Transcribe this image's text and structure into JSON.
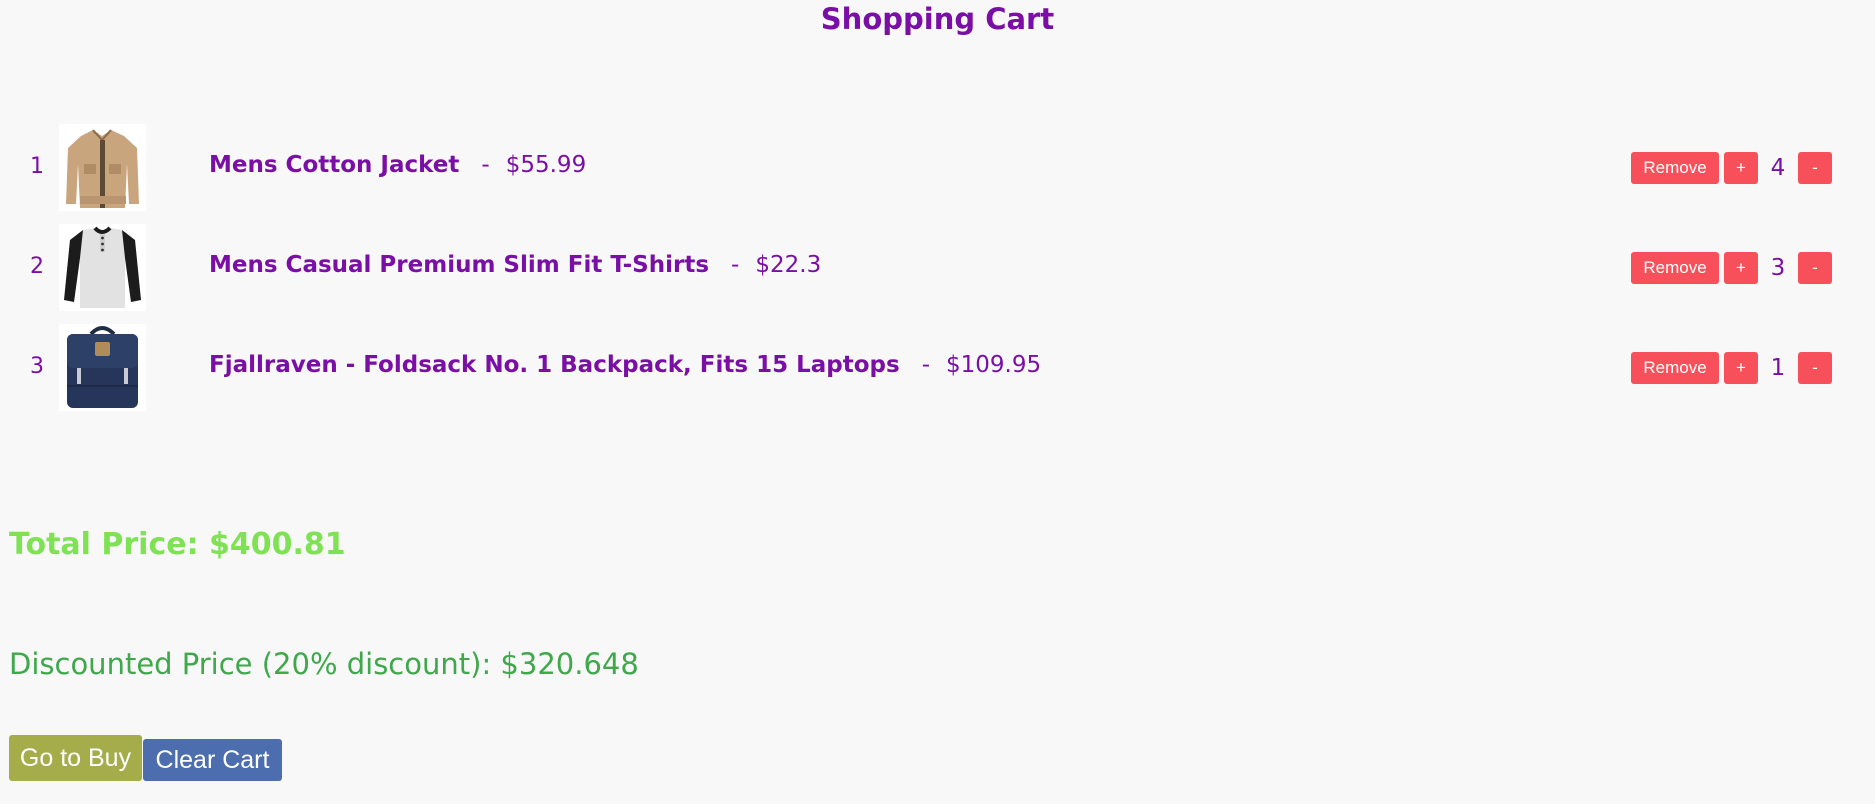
{
  "page": {
    "title": "Shopping Cart"
  },
  "items": [
    {
      "index": "1",
      "name": "Mens Cotton Jacket",
      "separator": "-",
      "price": "$55.99",
      "quantity": "4",
      "image_icon": "jacket-image"
    },
    {
      "index": "2",
      "name": "Mens Casual Premium Slim Fit T-Shirts",
      "separator": "-",
      "price": "$22.3",
      "quantity": "3",
      "image_icon": "tshirt-image"
    },
    {
      "index": "3",
      "name": "Fjallraven - Foldsack No. 1 Backpack, Fits 15 Laptops",
      "separator": "-",
      "price": "$109.95",
      "quantity": "1",
      "image_icon": "backpack-image"
    }
  ],
  "controls": {
    "remove_label": "Remove",
    "plus_label": "+",
    "minus_label": "-"
  },
  "summary": {
    "total": "Total Price: $400.81",
    "discounted": "Discounted Price (20% discount): $320.648"
  },
  "actions": {
    "buy_label": "Go to Buy",
    "clear_label": "Clear Cart"
  },
  "colors": {
    "text_purple": "#7a0fa5",
    "remove_red": "#f7505a",
    "total_green": "#7ee254",
    "discount_green": "#3ea84b",
    "buy_olive": "#a5ad4a",
    "clear_blue": "#4c6eaf"
  }
}
